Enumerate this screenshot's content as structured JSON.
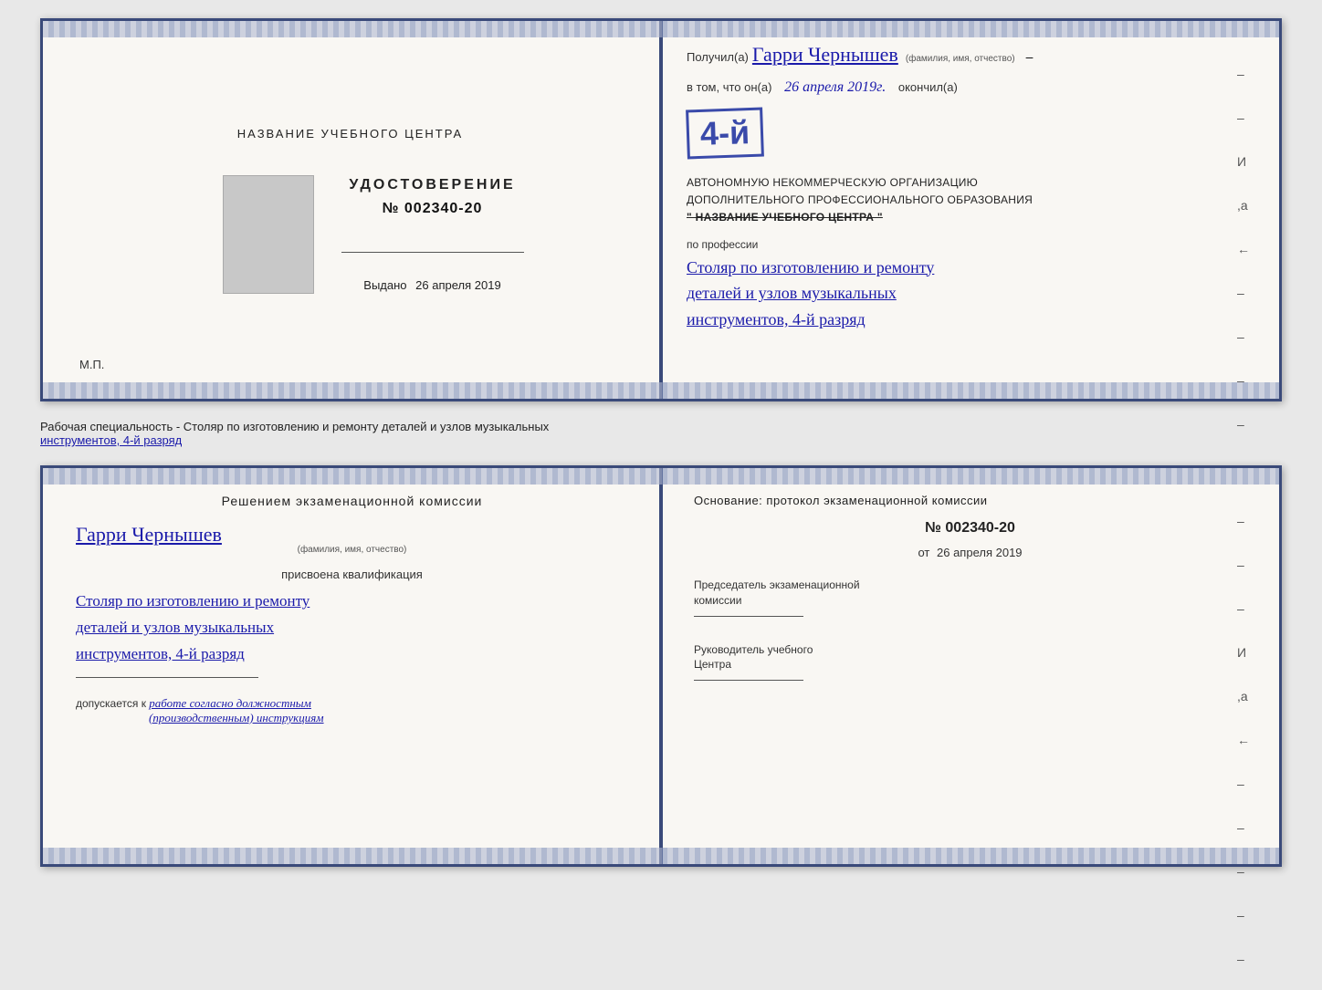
{
  "page": {
    "background_color": "#e8e8e8"
  },
  "top_spread": {
    "left_page": {
      "institution_label": "НАЗВАНИЕ УЧЕБНОГО ЦЕНТРА",
      "cert_type": "УДОСТОВЕРЕНИЕ",
      "cert_number_label": "№",
      "cert_number": "002340-20",
      "vydano_label": "Выдано",
      "vydano_date": "26 апреля 2019",
      "mp_label": "М.П."
    },
    "right_page": {
      "poluchil_label": "Получил(а)",
      "recipient_name": "Гарри Чернышев",
      "fio_sublabel": "(фамилия, имя, отчество)",
      "v_tom_label": "в том, что он(а)",
      "date_value": "26 апреля 2019г.",
      "okonchil_label": "окончил(а)",
      "stamp_number": "4-й",
      "stamp_line1": "АВТОНОМНУЮ НЕКОММЕРЧЕСКУЮ ОРГАНИЗАЦИЮ",
      "stamp_line2": "ДОПОЛНИТЕЛЬНОГО ПРОФЕССИОНАЛЬНОГО ОБРАЗОВАНИЯ",
      "stamp_line3": "\" НАЗВАНИЕ УЧЕБНОГО ЦЕНТРА \"",
      "po_professii_label": "по профессии",
      "profession_line1": "Столяр по изготовлению и ремонту",
      "profession_line2": "деталей и узлов музыкальных",
      "profession_line3": "инструментов, 4-й разряд"
    }
  },
  "subtitle": {
    "text_before": "Рабочая специальность - Столяр по изготовлению и ремонту деталей и узлов музыкальных",
    "text_underlined": "инструментов, 4-й разряд"
  },
  "bottom_spread": {
    "left_page": {
      "resheniem_title": "Решением  экзаменационной  комиссии",
      "person_name": "Гарри Чернышев",
      "fio_sublabel": "(фамилия, имя, отчество)",
      "prisvoena_label": "присвоена квалификация",
      "qual_line1": "Столяр по изготовлению и ремонту",
      "qual_line2": "деталей и узлов музыкальных",
      "qual_line3": "инструментов, 4-й разряд",
      "dopuskaetsya_label": "допускается к",
      "dopuskaetsya_text": "работе согласно должностным",
      "dopuskaetsya_text2": "(производственным) инструкциям"
    },
    "right_page": {
      "osnovanie_label": "Основание: протокол экзаменационной  комиссии",
      "number_label": "№",
      "number_value": "002340-20",
      "ot_label": "от",
      "ot_date": "26 апреля 2019",
      "predsedatel_label": "Председатель экзаменационной",
      "komissii_label": "комиссии",
      "rukovoditel_label": "Руководитель учебного",
      "centra_label": "Центра"
    }
  },
  "decorative": {
    "dash_chars": [
      "-",
      "-",
      "-",
      "И",
      ",а",
      "←",
      "-",
      "-",
      "-",
      "-",
      "-"
    ]
  }
}
